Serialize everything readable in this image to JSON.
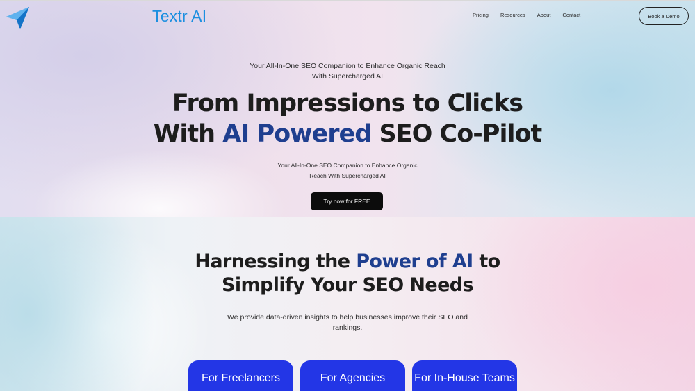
{
  "brand": {
    "name": "Textr AI",
    "logo_icon": "paper-plane-icon",
    "color": "#1c8fe0"
  },
  "nav": {
    "items": [
      "Pricing",
      "Resources",
      "About",
      "Contact"
    ]
  },
  "header": {
    "demo_button": "Book a Demo"
  },
  "hero": {
    "tagline_line1": "Your All-In-One SEO Companion to Enhance Organic Reach",
    "tagline_line2": "With Supercharged AI",
    "headline_line1": "From Impressions to Clicks",
    "headline_line2_pre": "With ",
    "headline_line2_accent": "AI Powered",
    "headline_line2_post": " SEO Co-Pilot",
    "subtext_line1": "Your All-In-One SEO Companion to Enhance Organic",
    "subtext_line2": "Reach With Supercharged AI",
    "cta_button": "Try now for FREE"
  },
  "features": {
    "heading_line1_pre": "Harnessing the ",
    "heading_line1_accent": "Power of AI",
    "heading_line1_post": " to",
    "heading_line2": "Simplify Your SEO Needs",
    "description_line1": "We provide data-driven insights to help businesses improve their SEO and",
    "description_line2": "rankings.",
    "cards": [
      "For Freelancers",
      "For Agencies",
      "For In-House Teams"
    ]
  },
  "colors": {
    "accent_text": "#1f3f8f",
    "card_blue": "#2336e6",
    "cta_black": "#0c0c0c"
  }
}
